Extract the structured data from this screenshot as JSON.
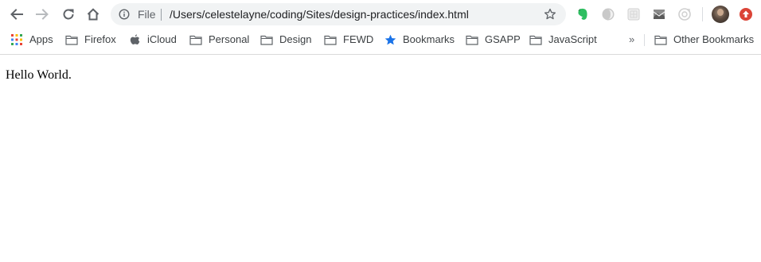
{
  "toolbar": {
    "back_icon": "arrow-left-icon",
    "forward_icon": "arrow-right-icon",
    "reload_icon": "reload-icon",
    "home_icon": "home-icon"
  },
  "omnibox": {
    "scheme_label": "File",
    "url": "/Users/celestelayne/coding/Sites/design-practices/index.html",
    "info_icon": "info-icon",
    "bookmark_icon": "star-icon"
  },
  "extensions": [
    "evernote-icon",
    "extension-icon",
    "extension-icon",
    "extension-icon",
    "extension-icon",
    "avatar",
    "extension-icon"
  ],
  "bookmarks": {
    "items": [
      {
        "label": "Apps",
        "icon": "apps-grid-icon"
      },
      {
        "label": "Firefox",
        "icon": "folder-icon"
      },
      {
        "label": "iCloud",
        "icon": "apple-icon"
      },
      {
        "label": "Personal",
        "icon": "folder-icon"
      },
      {
        "label": "Design",
        "icon": "folder-icon"
      },
      {
        "label": "FEWD",
        "icon": "folder-icon"
      },
      {
        "label": "Bookmarks",
        "icon": "star-icon"
      },
      {
        "label": "GSAPP",
        "icon": "folder-icon"
      },
      {
        "label": "JavaScript",
        "icon": "folder-icon"
      }
    ],
    "overflow_label": "»",
    "other_label": "Other Bookmarks"
  },
  "page": {
    "text": "Hello World."
  },
  "colors": {
    "omnibox_bg": "#f1f3f4",
    "bookmark_star": "#1a73e8",
    "evernote_green": "#2dbe60",
    "red_extension": "#db4437"
  }
}
